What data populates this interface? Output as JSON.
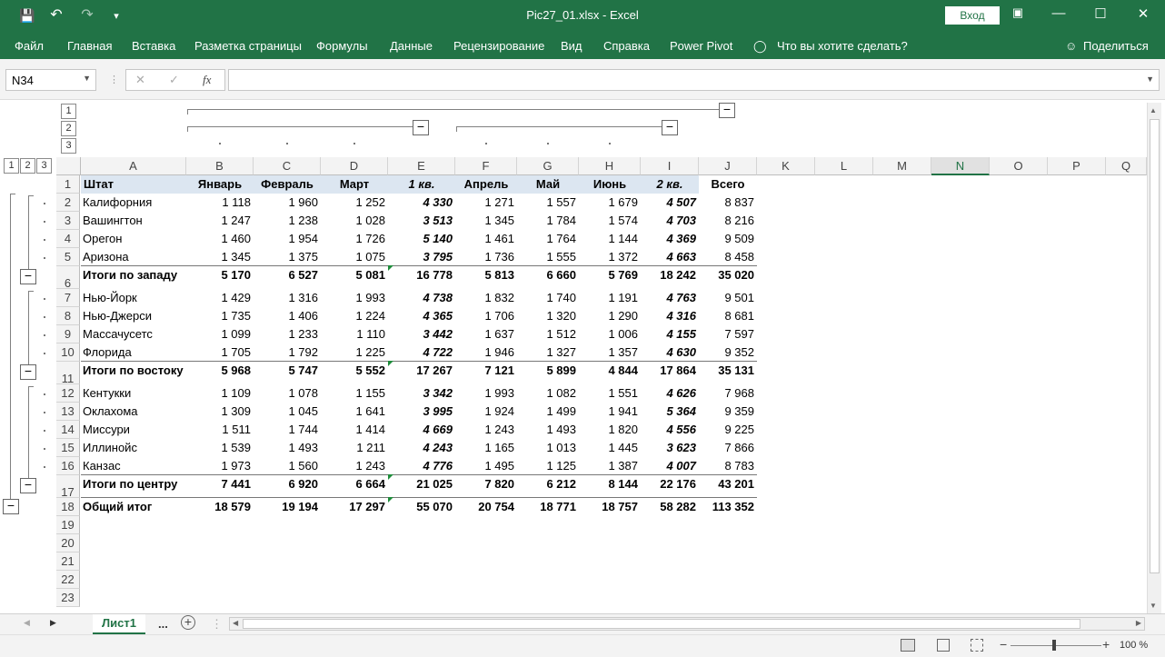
{
  "window": {
    "title": "Pic27_01.xlsx  -  Excel",
    "login_label": "Вход"
  },
  "ribbon": {
    "tabs": [
      "Файл",
      "Главная",
      "Вставка",
      "Разметка страницы",
      "Формулы",
      "Данные",
      "Рецензирование",
      "Вид",
      "Справка",
      "Power Pivot"
    ],
    "tell_me": "Что вы хотите сделать?",
    "share": "Поделиться"
  },
  "formula_bar": {
    "name_box": "N34",
    "fx": "fx",
    "formula": ""
  },
  "outline": {
    "column_levels": [
      "1",
      "2",
      "3"
    ],
    "row_levels": [
      "1",
      "2",
      "3"
    ],
    "collapse_symbol": "−"
  },
  "columns": [
    "A",
    "B",
    "C",
    "D",
    "E",
    "F",
    "G",
    "H",
    "I",
    "J",
    "K",
    "L",
    "M",
    "N",
    "O",
    "P",
    "Q"
  ],
  "selected_column": "N",
  "table": {
    "header": [
      "Штат",
      "Январь",
      "Февраль",
      "Март",
      "1 кв.",
      "Апрель",
      "Май",
      "Июнь",
      "2 кв.",
      "Всего"
    ],
    "rows": [
      {
        "n": "1",
        "type": "header"
      },
      {
        "n": "2",
        "type": "data",
        "cells": [
          "Калифорния",
          "1 118",
          "1 960",
          "1 252",
          "4 330",
          "1 271",
          "1 557",
          "1 679",
          "4 507",
          "8 837"
        ]
      },
      {
        "n": "3",
        "type": "data",
        "cells": [
          "Вашингтон",
          "1 247",
          "1 238",
          "1 028",
          "3 513",
          "1 345",
          "1 784",
          "1 574",
          "4 703",
          "8 216"
        ]
      },
      {
        "n": "4",
        "type": "data",
        "cells": [
          "Орегон",
          "1 460",
          "1 954",
          "1 726",
          "5 140",
          "1 461",
          "1 764",
          "1 144",
          "4 369",
          "9 509"
        ]
      },
      {
        "n": "5",
        "type": "data",
        "cells": [
          "Аризона",
          "1 345",
          "1 375",
          "1 075",
          "3 795",
          "1 736",
          "1 555",
          "1 372",
          "4 663",
          "8 458"
        ]
      },
      {
        "n": "6",
        "type": "total",
        "cells": [
          "Итоги по западу",
          "5 170",
          "6 527",
          "5 081",
          "16 778",
          "5 813",
          "6 660",
          "5 769",
          "18 242",
          "35 020"
        ]
      },
      {
        "n": "7",
        "type": "data",
        "cells": [
          "Нью-Йорк",
          "1 429",
          "1 316",
          "1 993",
          "4 738",
          "1 832",
          "1 740",
          "1 191",
          "4 763",
          "9 501"
        ]
      },
      {
        "n": "8",
        "type": "data",
        "cells": [
          "Нью-Джерси",
          "1 735",
          "1 406",
          "1 224",
          "4 365",
          "1 706",
          "1 320",
          "1 290",
          "4 316",
          "8 681"
        ]
      },
      {
        "n": "9",
        "type": "data",
        "cells": [
          "Массачусетс",
          "1 099",
          "1 233",
          "1 110",
          "3 442",
          "1 637",
          "1 512",
          "1 006",
          "4 155",
          "7 597"
        ]
      },
      {
        "n": "10",
        "type": "data",
        "cells": [
          "Флорида",
          "1 705",
          "1 792",
          "1 225",
          "4 722",
          "1 946",
          "1 327",
          "1 357",
          "4 630",
          "9 352"
        ]
      },
      {
        "n": "11",
        "type": "total",
        "cells": [
          "Итоги по востоку",
          "5 968",
          "5 747",
          "5 552",
          "17 267",
          "7 121",
          "5 899",
          "4 844",
          "17 864",
          "35 131"
        ]
      },
      {
        "n": "12",
        "type": "data",
        "cells": [
          "Кентукки",
          "1 109",
          "1 078",
          "1 155",
          "3 342",
          "1 993",
          "1 082",
          "1 551",
          "4 626",
          "7 968"
        ]
      },
      {
        "n": "13",
        "type": "data",
        "cells": [
          "Оклахома",
          "1 309",
          "1 045",
          "1 641",
          "3 995",
          "1 924",
          "1 499",
          "1 941",
          "5 364",
          "9 359"
        ]
      },
      {
        "n": "14",
        "type": "data",
        "cells": [
          "Миссури",
          "1 511",
          "1 744",
          "1 414",
          "4 669",
          "1 243",
          "1 493",
          "1 820",
          "4 556",
          "9 225"
        ]
      },
      {
        "n": "15",
        "type": "data",
        "cells": [
          "Иллинойс",
          "1 539",
          "1 493",
          "1 211",
          "4 243",
          "1 165",
          "1 013",
          "1 445",
          "3 623",
          "7 866"
        ]
      },
      {
        "n": "16",
        "type": "data",
        "cells": [
          "Канзас",
          "1 973",
          "1 560",
          "1 243",
          "4 776",
          "1 495",
          "1 125",
          "1 387",
          "4 007",
          "8 783"
        ]
      },
      {
        "n": "17",
        "type": "total",
        "cells": [
          "Итоги по центру",
          "7 441",
          "6 920",
          "6 664",
          "21 025",
          "7 820",
          "6 212",
          "8 144",
          "22 176",
          "43 201"
        ]
      },
      {
        "n": "18",
        "type": "grand",
        "cells": [
          "Общий итог",
          "18 579",
          "19 194",
          "17 297",
          "55 070",
          "20 754",
          "18 771",
          "18 757",
          "58 282",
          "113 352"
        ]
      },
      {
        "n": "19",
        "type": "empty"
      },
      {
        "n": "20",
        "type": "empty"
      },
      {
        "n": "21",
        "type": "empty"
      },
      {
        "n": "22",
        "type": "empty"
      },
      {
        "n": "23",
        "type": "empty"
      }
    ]
  },
  "sheet_tabs": {
    "active": "Лист1",
    "more": "...",
    "add": "+"
  },
  "status": {
    "zoom": "100 %"
  },
  "colors": {
    "excel_green": "#217346",
    "header_fill": "#dce6f1"
  }
}
